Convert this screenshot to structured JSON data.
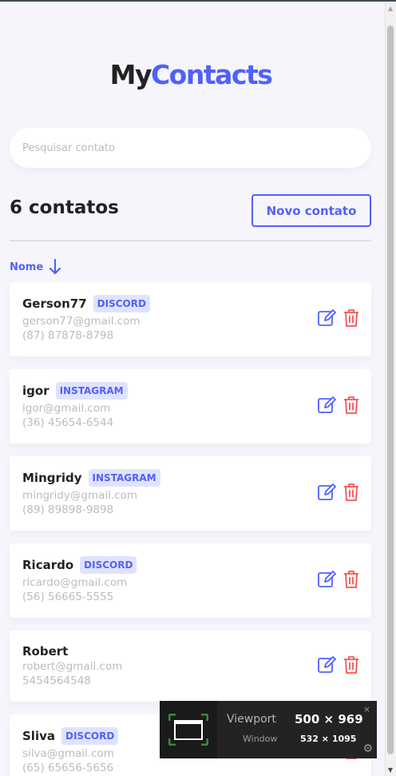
{
  "app": {
    "logo_my": "My",
    "logo_contacts": "Contacts",
    "brand_color": "#5061fc",
    "danger_color": "#fc5050"
  },
  "search": {
    "placeholder": "Pesquisar contato",
    "value": ""
  },
  "header": {
    "count_label": "6 contatos",
    "new_contact_label": "Novo contato"
  },
  "sort": {
    "label": "Nome",
    "icon": "arrow-down-icon"
  },
  "contacts": [
    {
      "name": "Gerson77",
      "category": "DISCORD",
      "email": "gerson77@gmail.com",
      "phone": "(87) 87878-8798"
    },
    {
      "name": "igor",
      "category": "INSTAGRAM",
      "email": "igor@gmail.com",
      "phone": "(36) 45654-6544"
    },
    {
      "name": "Mingridy",
      "category": "INSTAGRAM",
      "email": "mingridy@gmail.com",
      "phone": "(89) 89898-9898"
    },
    {
      "name": "Ricardo",
      "category": "DISCORD",
      "email": "ricardo@gmail.com",
      "phone": "(56) 56665-5555"
    },
    {
      "name": "Robert",
      "category": "",
      "email": "robert@gmail.com",
      "phone": "5454564548"
    },
    {
      "name": "Sliva",
      "category": "DISCORD",
      "email": "silva@gmail.com",
      "phone": "(65) 65656-5656"
    }
  ],
  "devtools": {
    "viewport_label": "Viewport",
    "viewport_value": "500 × 969",
    "window_label": "Window",
    "window_value": "532 × 1095",
    "close": "×",
    "gear": "⚙"
  }
}
